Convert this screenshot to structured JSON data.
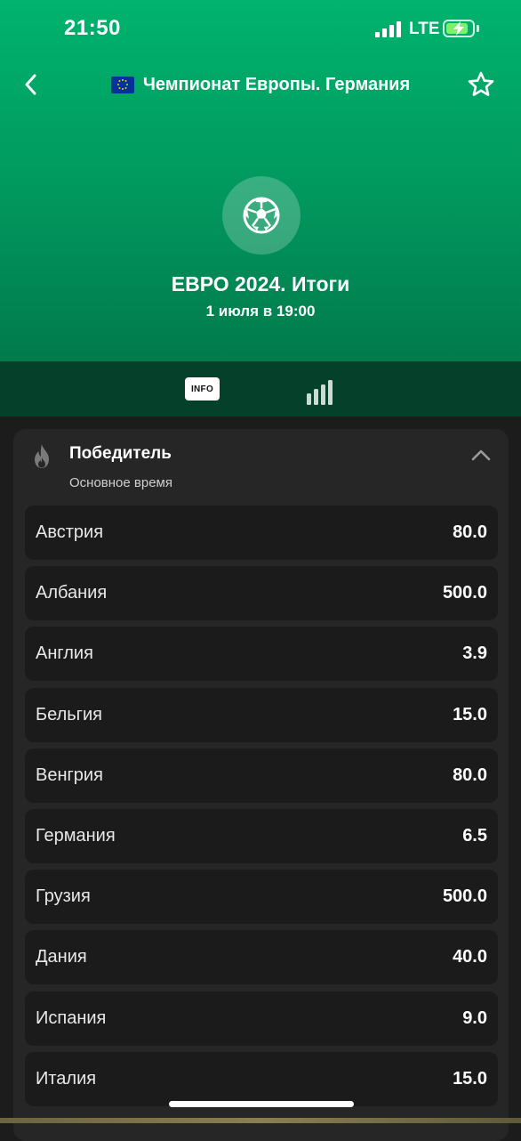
{
  "status_bar": {
    "time": "21:50",
    "network": "LTE",
    "battery_level": 0.85,
    "battery_color": "#7bf26b"
  },
  "header": {
    "back_icon": "chevron-left-icon",
    "flag_icon": "eu-flag-icon",
    "league_title": "Чемпионат Европы. Германия",
    "favorite_icon": "star-outline-icon",
    "sport_icon": "soccer-ball-icon",
    "event_title": "ЕВРО 2024. Итоги",
    "event_date": "1 июля в 19:00",
    "accent_color": "#00b36e"
  },
  "tabs": {
    "info_label": "INFO",
    "stats_icon": "bar-chart-icon"
  },
  "market": {
    "icon": "fire-icon",
    "title": "Победитель",
    "subtitle": "Основное время",
    "collapse_icon": "chevron-up-icon",
    "outcomes": [
      {
        "name": "Австрия",
        "odds": "80.0"
      },
      {
        "name": "Албания",
        "odds": "500.0"
      },
      {
        "name": "Англия",
        "odds": "3.9"
      },
      {
        "name": "Бельгия",
        "odds": "15.0"
      },
      {
        "name": "Венгрия",
        "odds": "80.0"
      },
      {
        "name": "Германия",
        "odds": "6.5"
      },
      {
        "name": "Грузия",
        "odds": "500.0"
      },
      {
        "name": "Дания",
        "odds": "40.0"
      },
      {
        "name": "Испания",
        "odds": "9.0"
      },
      {
        "name": "Италия",
        "odds": "15.0"
      }
    ]
  }
}
